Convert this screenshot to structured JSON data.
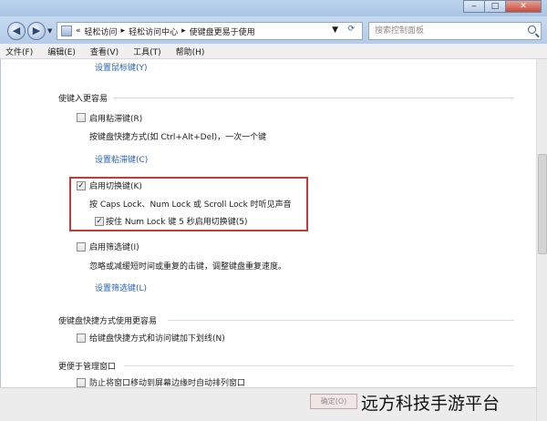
{
  "titlebar": {
    "minimize": "‒",
    "maximize": "□",
    "close": "✕"
  },
  "address": {
    "back_glyph": "◀",
    "forward_glyph": "▶",
    "chevrons": "«",
    "crumbs": [
      "轻松访问",
      "轻松访问中心",
      "使键盘更易于使用"
    ],
    "separator": "▸",
    "search_placeholder": "搜索控制面板"
  },
  "menu": {
    "items": [
      "文件(F)",
      "编辑(E)",
      "查看(V)",
      "工具(T)",
      "帮助(H)"
    ]
  },
  "content": {
    "top_link": "设置鼠标键(Y)",
    "section_easier": "使键入更容易",
    "sticky_label": "启用粘滞键(R)",
    "sticky_desc": "按键盘快捷方式(如 Ctrl+Alt+Del)，一次一个键",
    "sticky_link": "设置粘滞键(C)",
    "toggle_label": "启用切换键(K)",
    "toggle_desc": "按 Caps Lock、Num Lock 或 Scroll Lock 时听见声音",
    "numlock_label": "按住 Num Lock 键 5 秒启用切换键(5)",
    "filter_label": "启用筛选键(I)",
    "filter_desc": "忽略或减缓短时间或重复的击键，调整键盘重复速度。",
    "filter_link": "设置筛选键(L)",
    "section_shortcuts": "使键盘快捷方式使用更容易",
    "underline_label": "给键盘快捷方式和访问键加下划线(N)",
    "section_windows": "更便于管理窗口",
    "snap_label": "防止将窗口移动到屏幕边缘时自动排列窗口",
    "check_mark": "✓"
  },
  "footer": {
    "ok_label": "确定(O)"
  },
  "watermark": "远方科技手游平台"
}
